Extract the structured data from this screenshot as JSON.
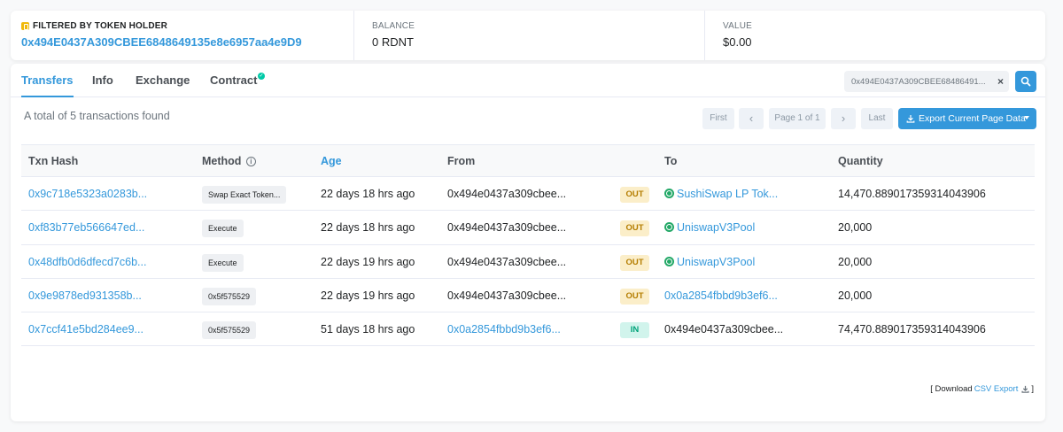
{
  "filter": {
    "label": "FILTERED BY TOKEN HOLDER",
    "address": "0x494E0437A309CBEE6848649135e8e6957aa4e9D9",
    "balance_label": "BALANCE",
    "balance_value": "0 RDNT",
    "value_label": "VALUE",
    "value_value": "$0.00"
  },
  "tabs": [
    {
      "label": "Transfers"
    },
    {
      "label": "Info"
    },
    {
      "label": "Exchange"
    },
    {
      "label": "Contract"
    }
  ],
  "search": {
    "value": "0x494E0437A309CBEE68486491..."
  },
  "summary": "A total of 5 transactions found",
  "pager": {
    "first": "First",
    "prev": "‹",
    "page": "Page 1 of 1",
    "next": "›",
    "last": "Last"
  },
  "export_label": "Export Current Page Data",
  "table": {
    "headers": {
      "hash": "Txn Hash",
      "method": "Method",
      "age": "Age",
      "from": "From",
      "to": "To",
      "quantity": "Quantity"
    },
    "rows": [
      {
        "hash": "0x9c718e5323a0283b...",
        "method": "Swap Exact Token...",
        "age": "22 days 18 hrs ago",
        "from": "0x494e0437a309cbee...",
        "dir": "OUT",
        "to": "SushiSwap LP Tok...",
        "quantity": "14,470.889017359314043906"
      },
      {
        "hash": "0xf83b77eb566647ed...",
        "method": "Execute",
        "age": "22 days 18 hrs ago",
        "from": "0x494e0437a309cbee...",
        "dir": "OUT",
        "to": "UniswapV3Pool",
        "quantity": "20,000"
      },
      {
        "hash": "0x48dfb0d6dfecd7c6b...",
        "method": "Execute",
        "age": "22 days 19 hrs ago",
        "from": "0x494e0437a309cbee...",
        "dir": "OUT",
        "to": "UniswapV3Pool",
        "quantity": "20,000"
      },
      {
        "hash": "0x9e9878ed931358b...",
        "method": "0x5f575529",
        "age": "22 days 19 hrs ago",
        "from": "0x494e0437a309cbee...",
        "dir": "OUT",
        "to": "0x0a2854fbbd9b3ef6...",
        "quantity": "20,000"
      },
      {
        "hash": "0x7ccf41e5bd284ee9...",
        "method": "0x5f575529",
        "age": "51 days 18 hrs ago",
        "from": "0x0a2854fbbd9b3ef6...",
        "dir": "IN",
        "to": "0x494e0437a309cbee...",
        "quantity": "74,470.889017359314043906"
      }
    ]
  },
  "csv": {
    "prefix": "[ Download",
    "link": "CSV Export",
    "suffix": "]"
  }
}
